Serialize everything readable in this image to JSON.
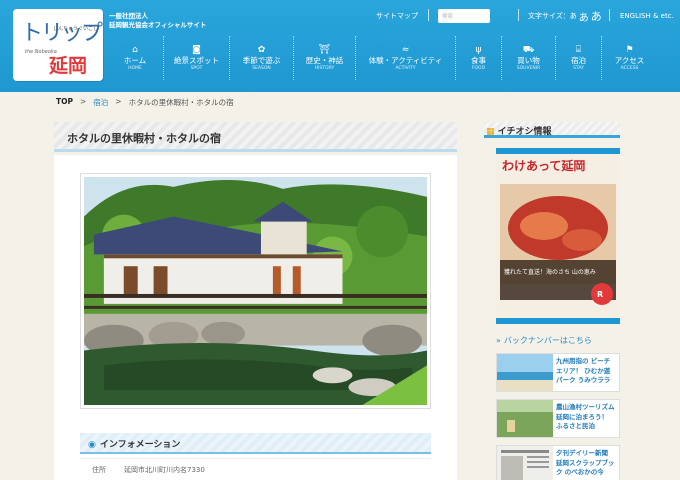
{
  "header": {
    "logo_script": "トリップ",
    "logo_small": "しんちゅうぐいごし",
    "logo_sub": "the Nobeoka",
    "logo_main": "延岡",
    "org_line1": "一般社団法人",
    "org_line2": "延岡観光協会オフィシャルサイト",
    "sitemap": "サイトマップ",
    "search_placeholder": "検索",
    "fontsize_label": "文字サイズ：",
    "fontsize_small": "あ",
    "fontsize_medium": "あ",
    "fontsize_large": "あ",
    "english": "ENGLISH & etc."
  },
  "nav": [
    {
      "ja": "ホーム",
      "en": "HOME",
      "icon": "home-icon",
      "glyph": "⌂"
    },
    {
      "ja": "絶景スポット",
      "en": "SPOT",
      "icon": "camera-icon",
      "glyph": "◙"
    },
    {
      "ja": "季節で遊ぶ",
      "en": "SEASON",
      "icon": "flower-icon",
      "glyph": "✿"
    },
    {
      "ja": "歴史・神話",
      "en": "HISTORY",
      "icon": "torii-icon",
      "glyph": "⛩"
    },
    {
      "ja": "体験・アクティビティ",
      "en": "ACTIVITY",
      "icon": "swimmer-icon",
      "glyph": "≈"
    },
    {
      "ja": "食事",
      "en": "FOOD",
      "icon": "fork-knife-icon",
      "glyph": "ψ"
    },
    {
      "ja": "買い物",
      "en": "SOUVENIR",
      "icon": "cart-icon",
      "glyph": "⛟"
    },
    {
      "ja": "宿泊",
      "en": "STAY",
      "icon": "bed-icon",
      "glyph": "⌸"
    },
    {
      "ja": "アクセス",
      "en": "ACCESS",
      "icon": "map-pin-icon",
      "glyph": "⚑"
    }
  ],
  "breadcrumb": {
    "top": "TOP",
    "sep": ">",
    "level1": "宿泊",
    "current": "ホタルの里休暇村・ホタルの宿"
  },
  "main": {
    "title": "ホタルの里休暇村・ホタルの宿",
    "info_title": "インフォメーション",
    "address_label": "住所",
    "address_value": "延岡市北川町川内名7330"
  },
  "sidebar": {
    "title": "イチオシ情報",
    "magazine_title": "わけあって延岡",
    "magazine_caption": "獲れたて直送！海のさち 山の恵み",
    "backnumber": "バックナンバーはこちら",
    "cards": [
      {
        "title": "九州屈指の ビーチエリア！ ひむか遊パーク うみウララ"
      },
      {
        "title": "農山漁村ツーリズム 延岡に泊まろう！ ふるさと民泊"
      },
      {
        "title": "夕刊デイリー新聞 延岡スクラップブック のべおかの今"
      }
    ]
  },
  "colors": {
    "header_blue": "#2aa6dc",
    "accent_blue": "#2a8ac4",
    "logo_red": "#e23a3a",
    "page_bg": "#f4f1e8"
  }
}
